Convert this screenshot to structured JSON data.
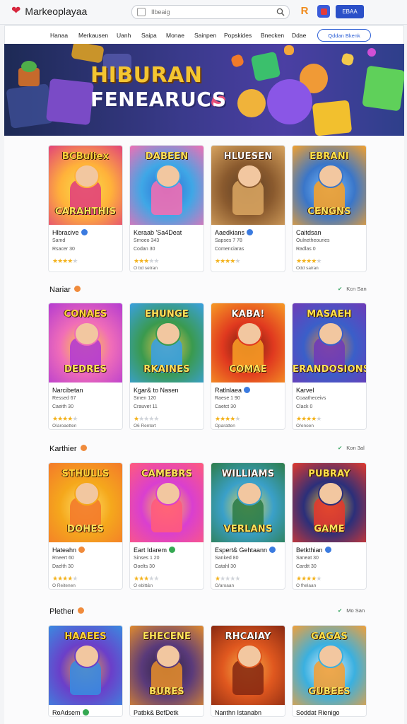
{
  "header": {
    "app_name": "Markeoplayaa",
    "search_placeholder": "Ilbeaig",
    "account_label": "EBAA"
  },
  "nav": {
    "items": [
      "Hanaa",
      "Merkausen",
      "Uanh",
      "Saipa",
      "Monae",
      "Sainpen",
      "Popskides",
      "Bnecken",
      "Ddae"
    ],
    "cta_label": "Qddan Bkenk"
  },
  "hero": {
    "title_line1": "HIBURAN",
    "title_line2": "FENEARUCS"
  },
  "rating_colors": {
    "on": "#f3b21c",
    "off": "#cfd3d9"
  },
  "sections": [
    {
      "title": "",
      "link": "",
      "cards": [
        {
          "art": "BCBuliex CARAHTHIS",
          "name": "Hlbracive",
          "badge": "#3b7be0",
          "line1": "Samd",
          "line2": "Rsacer 30",
          "stars": 3.5,
          "foot": ""
        },
        {
          "art": "DABEEN",
          "name": "Keraab 'Sa4Deat",
          "badge": "",
          "line1": "Srnoeo 343",
          "line2": "Codan 30",
          "stars": 3,
          "foot": "O bd setran"
        },
        {
          "art": "HLUESEN",
          "name": "Aaedkians",
          "badge": "#3b7be0",
          "line1": "Sapses 7 78",
          "line2": "Comenciaras",
          "stars": 4,
          "foot": ""
        },
        {
          "art": "EBRANI CENGNS",
          "name": "Caitdsan",
          "badge": "",
          "line1": "Oulnetheouries",
          "line2": "Radlas 0",
          "stars": 4,
          "foot": "Odd sairan"
        }
      ]
    },
    {
      "title": "Nariar",
      "link": "Kcn San",
      "cards": [
        {
          "art": "CONAES DEDRES",
          "name": "Narcibetan",
          "badge": "",
          "line1": "Ressed 67",
          "line2": "Caeith 30",
          "stars": 4,
          "foot": "O/aroaetten"
        },
        {
          "art": "EHUNGE RKAINES",
          "name": "Kgar& to Nasen",
          "badge": "",
          "line1": "Smen 120",
          "line2": "Crauvet 11",
          "stars": 1,
          "foot": "O6 Rentert"
        },
        {
          "art": "KABA! COMAE",
          "name": "Ratlnlaea",
          "badge": "#3b7be0",
          "line1": "Raese 1 90",
          "line2": "Caetct 30",
          "stars": 4,
          "foot": "Oparatten"
        },
        {
          "art": "MASAEH ERANDOSIONS",
          "name": "Karvel",
          "badge": "",
          "line1": "Coaatheceivs",
          "line2": "Clack 0",
          "stars": 4,
          "foot": "O/enoen"
        }
      ]
    },
    {
      "title": "Karthier",
      "link": "Kon 3al",
      "cards": [
        {
          "art": "STHULLS DOHES",
          "name": "Hateahn",
          "badge": "#f08b3c",
          "line1": "Rneert 60",
          "line2": "Daelth 30",
          "stars": 3.5,
          "foot": "O Reitenen"
        },
        {
          "art": "CAMEBRS",
          "name": "Eart Idarem",
          "badge": "#35a852",
          "line1": "Sinses 1 20",
          "line2": "Ooelts 30",
          "stars": 3,
          "foot": "O ebitt&n"
        },
        {
          "art": "WILLIAMS VERLANS",
          "name": "Espert& Gehtaann",
          "badge": "#3b7be0",
          "line1": "Sanked 80",
          "line2": "Catahl 30",
          "stars": 1,
          "foot": "O/aroaan"
        },
        {
          "art": "PUBRAY GAME",
          "name": "Betkthian",
          "badge": "#3b7be0",
          "line1": "Saneat 30",
          "line2": "Cardtt 30",
          "stars": 4,
          "foot": "O fhelaan"
        }
      ]
    },
    {
      "title": "Plether",
      "link": "Mo San",
      "cards": [
        {
          "art": "HAAEES",
          "name": "RoAdsem",
          "badge": "#35a852",
          "line1": "",
          "line2": "",
          "stars": 0,
          "foot": ""
        },
        {
          "art": "EHECENE BURES",
          "name": "Patbk& BefDetk",
          "badge": "",
          "line1": "",
          "line2": "",
          "stars": 0,
          "foot": ""
        },
        {
          "art": "RHCAIAY",
          "name": "Nanthn Istanabn",
          "badge": "",
          "line1": "",
          "line2": "",
          "stars": 0,
          "foot": ""
        },
        {
          "art": "GAGAS GUBEES",
          "name": "Soddat Rienigo",
          "badge": "",
          "line1": "",
          "line2": "",
          "stars": 0,
          "foot": ""
        }
      ]
    }
  ]
}
